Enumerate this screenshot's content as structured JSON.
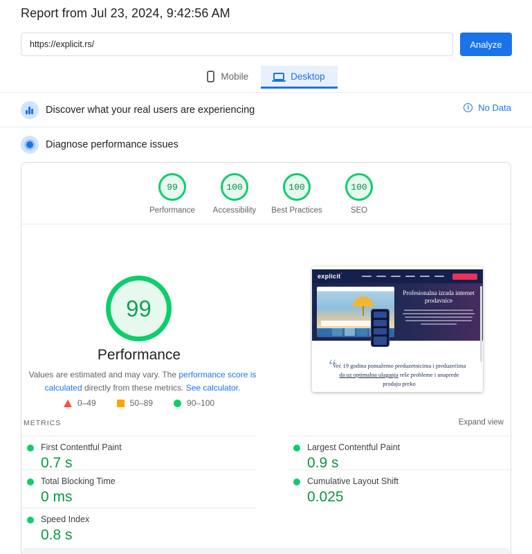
{
  "page": {
    "title": "Report from Jul 23, 2024, 9:42:56 AM"
  },
  "url_bar": {
    "value": "https://explicit.rs/",
    "analyze_label": "Analyze"
  },
  "tabs": {
    "mobile_label": "Mobile",
    "desktop_label": "Desktop",
    "active": "Desktop"
  },
  "field_section": {
    "title": "Discover what your real users are experiencing",
    "status_label": "No Data"
  },
  "lab_section": {
    "title": "Diagnose performance issues"
  },
  "category_scores": [
    {
      "label": "Performance",
      "value": "99"
    },
    {
      "label": "Accessibility",
      "value": "100"
    },
    {
      "label": "Best Practices",
      "value": "100"
    },
    {
      "label": "SEO",
      "value": "100"
    }
  ],
  "gauge": {
    "score": "99",
    "label": "Performance"
  },
  "disclaimer": {
    "prefix": "Values are estimated and may vary. The ",
    "link_calculated": "performance score is calculated",
    "middle": " directly from these metrics. ",
    "link_calculator": "See calculator."
  },
  "legend": [
    {
      "label": "0–49",
      "shape": "triangle",
      "color": "#ff4e42"
    },
    {
      "label": "50–89",
      "shape": "square",
      "color": "#ffa400"
    },
    {
      "label": "90–100",
      "shape": "circle",
      "color": "#0cce6b"
    }
  ],
  "metrics_header": {
    "title": "METRICS",
    "expand_label": "Expand view"
  },
  "metrics": [
    {
      "label": "First Contentful Paint",
      "value": "0.7 s"
    },
    {
      "label": "Largest Contentful Paint",
      "value": "0.9 s"
    },
    {
      "label": "Total Blocking Time",
      "value": "0 ms"
    },
    {
      "label": "Cumulative Layout Shift",
      "value": "0.025"
    },
    {
      "label": "Speed Index",
      "value": "0.8 s"
    }
  ],
  "site_preview": {
    "logo": "explicit",
    "hero_title": "Profesionalna izrada internet prodavnice",
    "quote_mark": "“",
    "quote_start": "Već 19 godina pomažemo preduzetnicima i preduzećima ",
    "quote_link": "da uz optimalna ulaganja",
    "quote_end": " reše probleme i unaprede prodaju preko"
  },
  "colors": {
    "accent_blue": "#1a73e8",
    "good_green": "#0cce6b",
    "average_orange": "#ffa400",
    "poor_red": "#ff4e42"
  }
}
